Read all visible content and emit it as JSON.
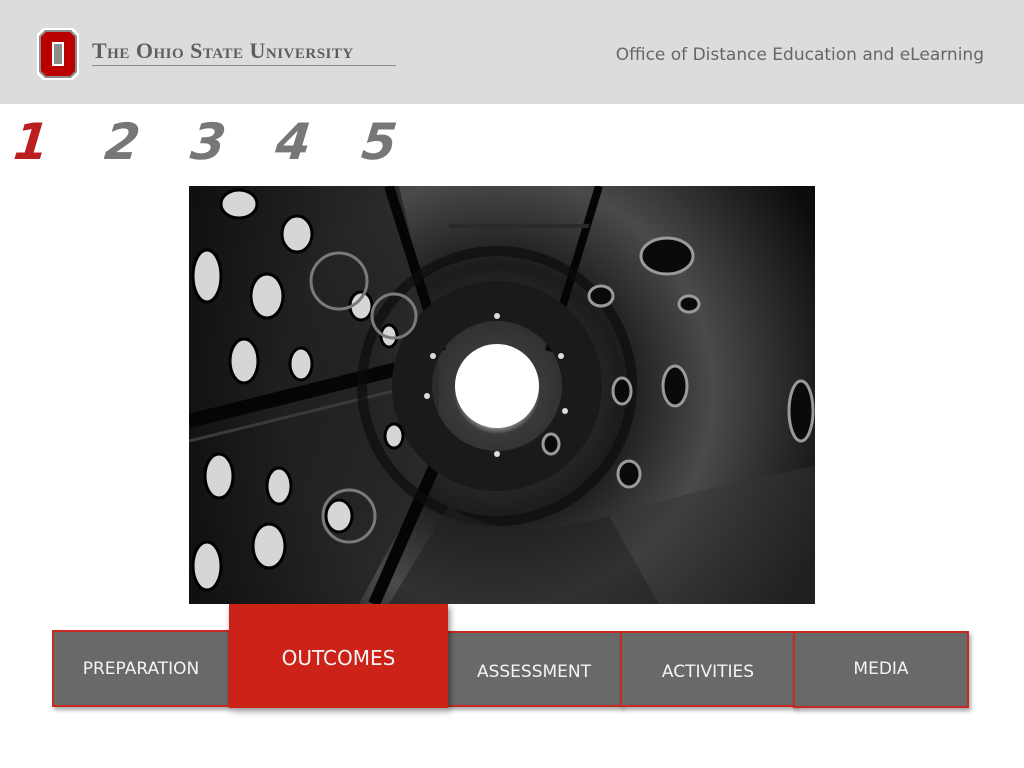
{
  "header": {
    "university_name": "The Ohio State University",
    "office_name": "Office of Distance Education and eLearning",
    "logo_icon": "block-o-logo-icon",
    "brand_color": "#bb0000"
  },
  "steps": {
    "items": [
      "1",
      "2",
      "3",
      "4",
      "5"
    ],
    "active": "1",
    "active_color": "#bb1e1e",
    "inactive_color": "#777777"
  },
  "photo": {
    "icon": "tunnel-photo"
  },
  "tabs": {
    "items": [
      {
        "label": "PREPARATION"
      },
      {
        "label": "OUTCOMES"
      },
      {
        "label": "ASSESSMENT"
      },
      {
        "label": "ACTIVITIES"
      },
      {
        "label": "MEDIA"
      }
    ],
    "active": "OUTCOMES",
    "active_color": "#cc2218",
    "inactive_color": "#696969"
  }
}
